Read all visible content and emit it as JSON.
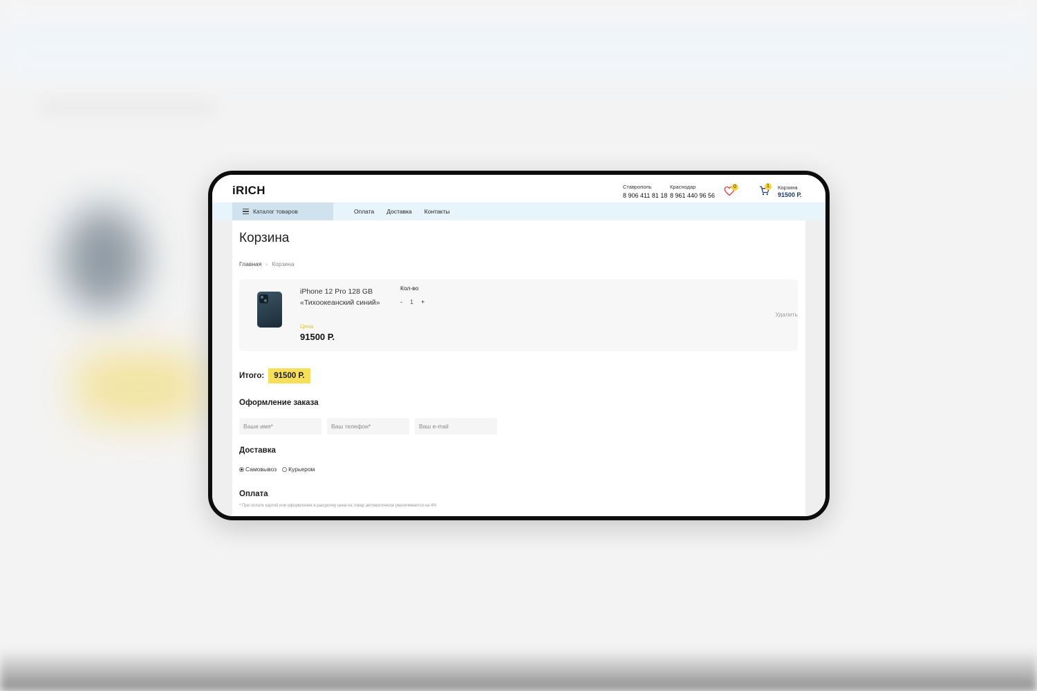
{
  "header": {
    "logo": "iRICH",
    "contacts": [
      {
        "city": "Ставрополь",
        "phone": "8 906 411 81 18"
      },
      {
        "city": "Краснодар",
        "phone": "8 961 440 96 56"
      }
    ],
    "favorites_count": "0",
    "cart_count": "1",
    "cart_label": "Корзина",
    "cart_sum": "91500 Р."
  },
  "nav": {
    "catalog": "Каталог товаров",
    "links": [
      "Оплата",
      "Доставка",
      "Контакты"
    ]
  },
  "page": {
    "title": "Корзина",
    "breadcrumb": {
      "home": "Главная",
      "current": "Корзина"
    }
  },
  "cart_item": {
    "name": "iPhone 12 Pro 128 GB «Тихоокеанский синий»",
    "price_label": "Цена",
    "price": "91500 Р.",
    "qty_label": "Кол-во",
    "qty_minus": "-",
    "qty": "1",
    "qty_plus": "+",
    "delete": "Удалить"
  },
  "total": {
    "label": "Итого:",
    "value": "91500 Р."
  },
  "order": {
    "title": "Оформление заказа",
    "name_placeholder": "Ваше имя*",
    "phone_placeholder": "Ваш телефон*",
    "email_placeholder": "Ваш e-mail"
  },
  "delivery": {
    "title": "Доставка",
    "options": [
      "Самовывоз",
      "Курьером"
    ],
    "selected": "Самовывоз"
  },
  "payment": {
    "title": "Оплата",
    "note": "* При оплате картой или оформлении в рассрочку цена на товар автоматически увеличивается на 4%"
  },
  "colors": {
    "accent_yellow": "#f8df5a",
    "nav_bg": "#e8f4fb",
    "cart_sum": "#1e3a6b"
  }
}
